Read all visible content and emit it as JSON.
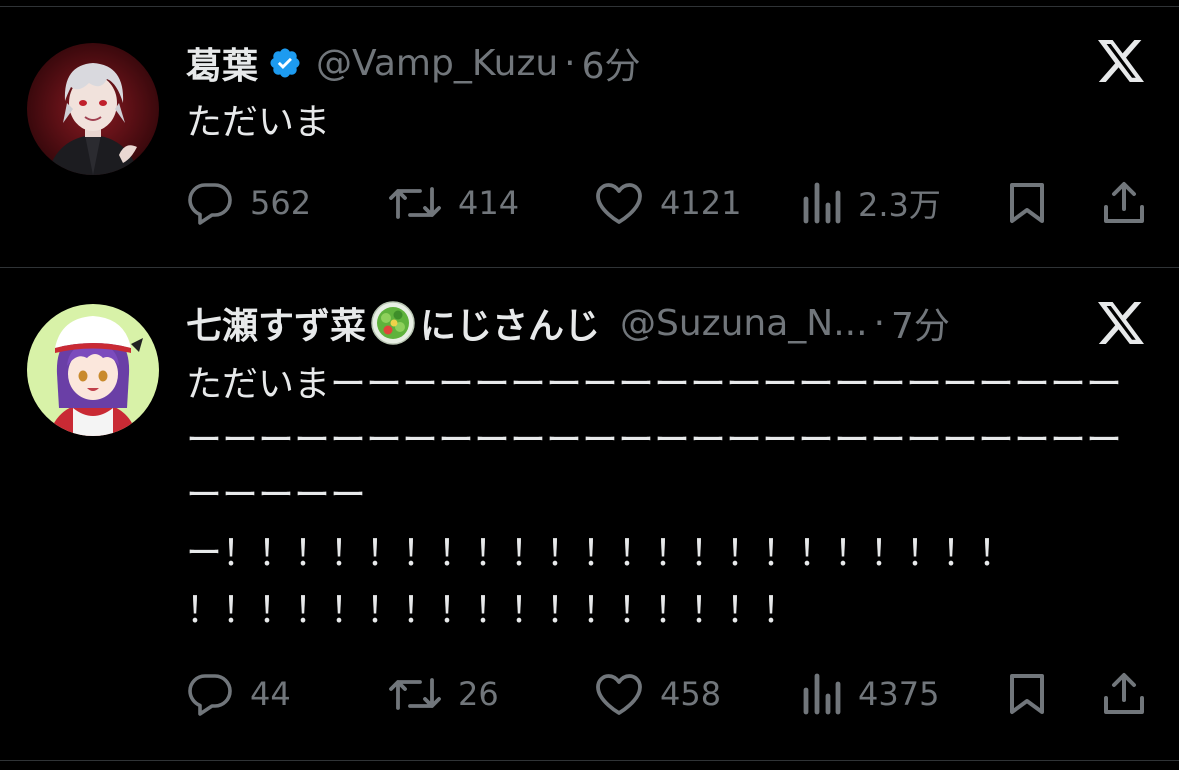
{
  "tweets": [
    {
      "name": "葛葉",
      "verified": true,
      "handle": "@Vamp_Kuzu",
      "separator": "·",
      "time": "6分",
      "text": "ただいま",
      "replies": "562",
      "retweets": "414",
      "likes": "4121",
      "views": "2.3万"
    },
    {
      "name": "七瀬すず菜",
      "name_suffix": "にじさんじ",
      "handle": "@Suzuna_N...",
      "separator": "·",
      "time": "7分",
      "text_lines": [
        "ただいまーーーーーーーーーーーーーーーーーーーーーー",
        "ーーーーーーーーーーーーーーーーーーーーーーーーーー",
        "ーーーーー",
        "ー！！！！！！！！！！！！！！！！！！！！！！",
        "！！！！！！！！！！！！！！！！！"
      ],
      "replies": "44",
      "retweets": "26",
      "likes": "458",
      "views": "4375"
    }
  ],
  "icons": {
    "verified": "verified-badge-icon",
    "reply": "reply-bubble-icon",
    "retweet": "retweet-icon",
    "like": "heart-icon",
    "views": "bar-chart-icon",
    "bookmark": "bookmark-icon",
    "share": "share-upload-icon",
    "brand": "x-logo-icon"
  },
  "colors": {
    "background": "#000000",
    "text": "#e7e9ea",
    "secondary": "#71767b",
    "divider": "#2f3336",
    "verified": "#1d9bf0"
  }
}
